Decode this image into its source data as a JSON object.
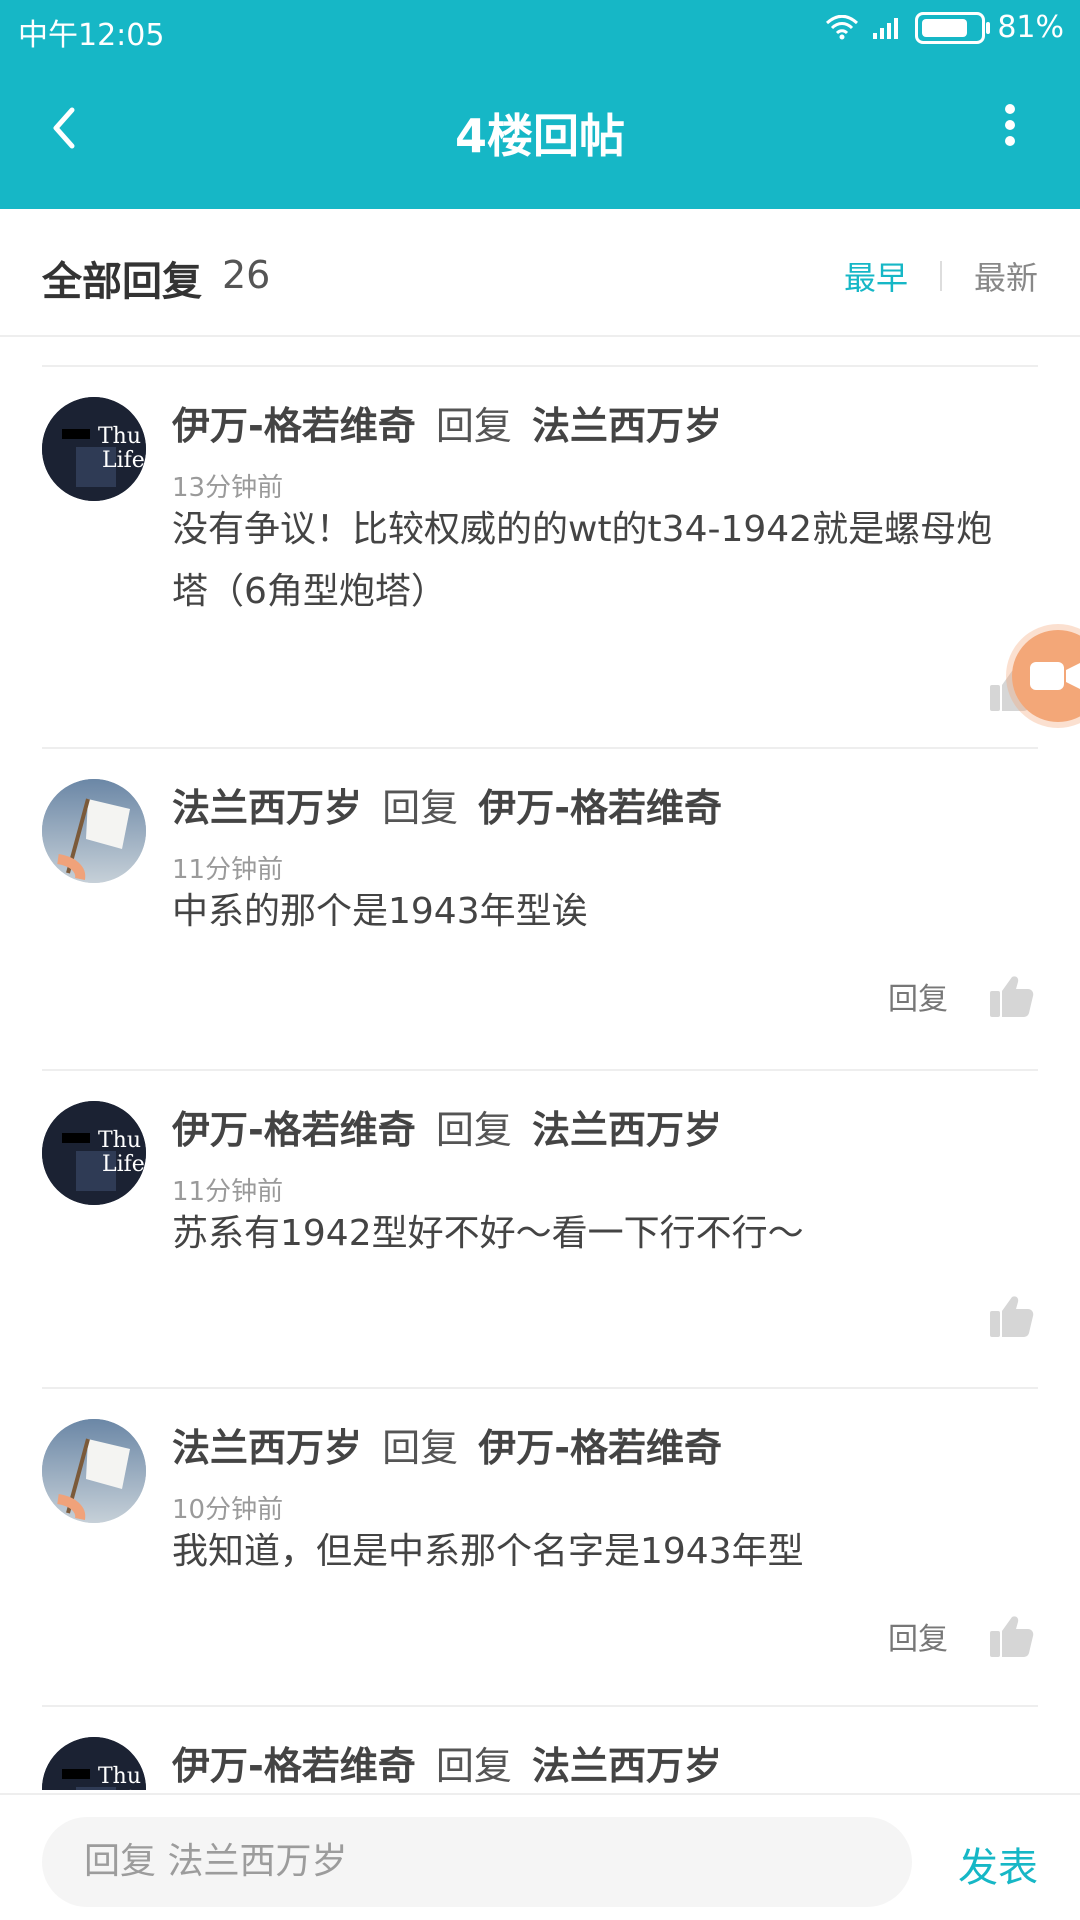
{
  "status_bar": {
    "time": "中午12:05",
    "battery_text": "81%",
    "battery_level": 0.81
  },
  "header": {
    "title": "4楼回帖",
    "back_icon": "back-chevron-icon",
    "more_icon": "more-vertical-icon"
  },
  "section": {
    "title": "全部回复",
    "count": "26",
    "tab_early": "最早",
    "tab_new": "最新"
  },
  "comments": [
    {
      "avatar": "thug-life-avatar",
      "user": "伊万-格若维奇",
      "reply_word": "回复",
      "reply_to": "法兰西万岁",
      "time": "13分钟前",
      "content": "没有争议！比较权威的的wt的t34-1942就是螺母炮塔（6角型炮塔）",
      "has_reply_button": false,
      "reply_label": ""
    },
    {
      "avatar": "white-flag-avatar",
      "user": "法兰西万岁",
      "reply_word": "回复",
      "reply_to": "伊万-格若维奇",
      "time": "11分钟前",
      "content": "中系的那个是1943年型诶",
      "has_reply_button": true,
      "reply_label": "回复"
    },
    {
      "avatar": "thug-life-avatar",
      "user": "伊万-格若维奇",
      "reply_word": "回复",
      "reply_to": "法兰西万岁",
      "time": "11分钟前",
      "content": "苏系有1942型好不好～看一下行不行～",
      "has_reply_button": false,
      "reply_label": ""
    },
    {
      "avatar": "white-flag-avatar",
      "user": "法兰西万岁",
      "reply_word": "回复",
      "reply_to": "伊万-格若维奇",
      "time": "10分钟前",
      "content": "我知道，但是中系那个名字是1943年型",
      "has_reply_button": true,
      "reply_label": "回复"
    },
    {
      "avatar": "thug-life-avatar",
      "user": "伊万-格若维奇",
      "reply_word": "回复",
      "reply_to": "法兰西万岁"
    }
  ],
  "bottom_bar": {
    "placeholder": "回复 法兰西万岁",
    "send_label": "发表"
  },
  "colors": {
    "accent": "#16b7c6",
    "floating_button": "#f3a778"
  }
}
